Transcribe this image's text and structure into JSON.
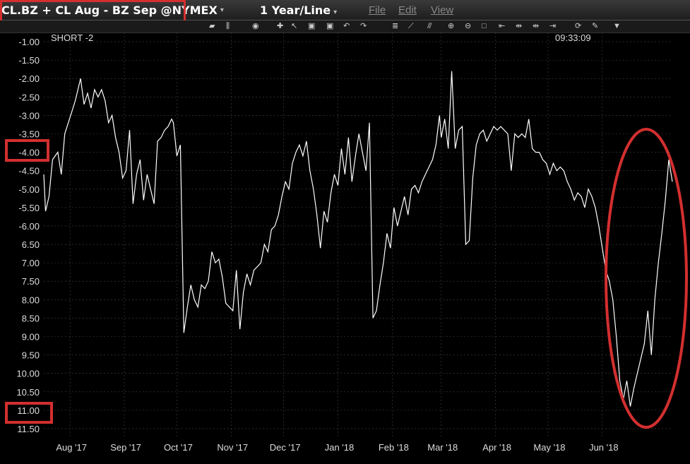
{
  "header": {
    "symbol": "CL.BZ + CL Aug - BZ Sep @NYMEX",
    "period": "1 Year/Line",
    "menu": [
      "File",
      "Edit",
      "View"
    ]
  },
  "legend": {
    "label": "SHORT -2",
    "time": "09:33:09"
  },
  "colors": {
    "background": "#000000",
    "line": "#ffffff",
    "annotation": "#d32f2f",
    "grid": "#444444"
  },
  "chart_data": {
    "type": "line",
    "ylim": [
      -11.75,
      -0.75
    ],
    "yticks": [
      "-1.00",
      "-1.50",
      "-2.00",
      "-2.50",
      "-3.00",
      "-3.50",
      "-4.00",
      "-4.50",
      "-5.00",
      "-5.50",
      "-6.00",
      "-6.50",
      "-7.00",
      "-7.50",
      "-8.00",
      "-8.50",
      "-9.00",
      "-9.50",
      "-10.00",
      "-10.50",
      "-11.00",
      "-11.50"
    ],
    "ytick_display": [
      "-1.00",
      "-1.50",
      "-2.00",
      "-2.50",
      "-3.00",
      "-3.50",
      "-4.00",
      "-4.50",
      "-5.00",
      "-5.50",
      "-6.00",
      "6.50",
      "7.00",
      "7.50",
      "8.00",
      "8.50",
      "9.00",
      "9.50",
      "10.00",
      "10.50",
      "11.00",
      "11.50"
    ],
    "months": [
      "Aug '17",
      "Sep '17",
      "Oct '17",
      "Nov '17",
      "Dec '17",
      "Jan '18",
      "Feb '18",
      "Mar '18",
      "Apr '18",
      "May '18",
      "Jun '18"
    ],
    "x_start": "2017-07-17",
    "x_end": "2018-07-11",
    "highlighted_ticks": [
      "-4.00",
      "-11.00"
    ],
    "series": [
      {
        "values": [
          [
            "2017-07-17",
            -4.6
          ],
          [
            "2017-07-18",
            -5.6
          ],
          [
            "2017-07-20",
            -5.2
          ],
          [
            "2017-07-22",
            -4.2
          ],
          [
            "2017-07-25",
            -4.0
          ],
          [
            "2017-07-27",
            -4.6
          ],
          [
            "2017-07-29",
            -3.5
          ],
          [
            "2017-07-31",
            -3.2
          ],
          [
            "2017-08-02",
            -2.9
          ],
          [
            "2017-08-04",
            -2.6
          ],
          [
            "2017-08-07",
            -2.0
          ],
          [
            "2017-08-09",
            -2.7
          ],
          [
            "2017-08-11",
            -2.4
          ],
          [
            "2017-08-13",
            -2.8
          ],
          [
            "2017-08-15",
            -2.3
          ],
          [
            "2017-08-17",
            -2.5
          ],
          [
            "2017-08-19",
            -2.3
          ],
          [
            "2017-08-21",
            -2.6
          ],
          [
            "2017-08-23",
            -3.2
          ],
          [
            "2017-08-25",
            -3.0
          ],
          [
            "2017-08-27",
            -3.6
          ],
          [
            "2017-08-29",
            -4.0
          ],
          [
            "2017-08-31",
            -4.7
          ],
          [
            "2017-09-02",
            -4.5
          ],
          [
            "2017-09-04",
            -3.4
          ],
          [
            "2017-09-06",
            -5.4
          ],
          [
            "2017-09-08",
            -4.6
          ],
          [
            "2017-09-10",
            -4.2
          ],
          [
            "2017-09-12",
            -5.3
          ],
          [
            "2017-09-14",
            -4.6
          ],
          [
            "2017-09-16",
            -5.0
          ],
          [
            "2017-09-18",
            -5.4
          ],
          [
            "2017-09-20",
            -3.7
          ],
          [
            "2017-09-22",
            -3.6
          ],
          [
            "2017-09-24",
            -3.4
          ],
          [
            "2017-09-26",
            -3.3
          ],
          [
            "2017-09-28",
            -3.1
          ],
          [
            "2017-09-29",
            -3.2
          ],
          [
            "2017-10-01",
            -4.1
          ],
          [
            "2017-10-03",
            -3.8
          ],
          [
            "2017-10-05",
            -8.9
          ],
          [
            "2017-10-07",
            -8.2
          ],
          [
            "2017-10-09",
            -7.6
          ],
          [
            "2017-10-11",
            -8.0
          ],
          [
            "2017-10-13",
            -8.2
          ],
          [
            "2017-10-15",
            -7.6
          ],
          [
            "2017-10-17",
            -7.7
          ],
          [
            "2017-10-19",
            -7.5
          ],
          [
            "2017-10-21",
            -6.7
          ],
          [
            "2017-10-23",
            -7.0
          ],
          [
            "2017-10-25",
            -6.9
          ],
          [
            "2017-10-27",
            -7.4
          ],
          [
            "2017-10-29",
            -8.1
          ],
          [
            "2017-10-31",
            -8.2
          ],
          [
            "2017-11-02",
            -8.3
          ],
          [
            "2017-11-04",
            -7.2
          ],
          [
            "2017-11-06",
            -8.8
          ],
          [
            "2017-11-08",
            -7.8
          ],
          [
            "2017-11-10",
            -7.3
          ],
          [
            "2017-11-12",
            -7.6
          ],
          [
            "2017-11-14",
            -7.2
          ],
          [
            "2017-11-16",
            -7.1
          ],
          [
            "2017-11-18",
            -7.0
          ],
          [
            "2017-11-20",
            -6.5
          ],
          [
            "2017-11-22",
            -6.7
          ],
          [
            "2017-11-24",
            -6.1
          ],
          [
            "2017-11-26",
            -6.0
          ],
          [
            "2017-11-28",
            -5.7
          ],
          [
            "2017-11-30",
            -5.2
          ],
          [
            "2017-12-02",
            -4.8
          ],
          [
            "2017-12-04",
            -5.0
          ],
          [
            "2017-12-06",
            -4.3
          ],
          [
            "2017-12-08",
            -4.0
          ],
          [
            "2017-12-10",
            -3.8
          ],
          [
            "2017-12-12",
            -4.1
          ],
          [
            "2017-12-14",
            -3.7
          ],
          [
            "2017-12-16",
            -4.5
          ],
          [
            "2017-12-18",
            -5.0
          ],
          [
            "2017-12-20",
            -5.7
          ],
          [
            "2017-12-22",
            -6.6
          ],
          [
            "2017-12-24",
            -5.6
          ],
          [
            "2017-12-26",
            -5.9
          ],
          [
            "2017-12-28",
            -5.1
          ],
          [
            "2017-12-30",
            -4.6
          ],
          [
            "2018-01-01",
            -4.9
          ],
          [
            "2018-01-03",
            -3.9
          ],
          [
            "2018-01-05",
            -4.6
          ],
          [
            "2018-01-07",
            -3.6
          ],
          [
            "2018-01-09",
            -4.8
          ],
          [
            "2018-01-11",
            -4.1
          ],
          [
            "2018-01-13",
            -3.5
          ],
          [
            "2018-01-15",
            -4.0
          ],
          [
            "2018-01-17",
            -4.5
          ],
          [
            "2018-01-19",
            -3.2
          ],
          [
            "2018-01-21",
            -8.5
          ],
          [
            "2018-01-23",
            -8.3
          ],
          [
            "2018-01-25",
            -7.6
          ],
          [
            "2018-01-27",
            -7.0
          ],
          [
            "2018-01-29",
            -6.2
          ],
          [
            "2018-01-31",
            -6.6
          ],
          [
            "2018-02-02",
            -5.5
          ],
          [
            "2018-02-04",
            -6.0
          ],
          [
            "2018-02-06",
            -5.6
          ],
          [
            "2018-02-08",
            -5.2
          ],
          [
            "2018-02-10",
            -5.7
          ],
          [
            "2018-02-12",
            -5.0
          ],
          [
            "2018-02-14",
            -4.9
          ],
          [
            "2018-02-16",
            -5.1
          ],
          [
            "2018-02-18",
            -4.8
          ],
          [
            "2018-02-20",
            -4.6
          ],
          [
            "2018-02-22",
            -4.4
          ],
          [
            "2018-02-24",
            -4.2
          ],
          [
            "2018-02-26",
            -3.8
          ],
          [
            "2018-02-28",
            -3.0
          ],
          [
            "2018-03-01",
            -3.6
          ],
          [
            "2018-03-03",
            -3.1
          ],
          [
            "2018-03-05",
            -3.9
          ],
          [
            "2018-03-07",
            -1.8
          ],
          [
            "2018-03-09",
            -3.9
          ],
          [
            "2018-03-11",
            -3.4
          ],
          [
            "2018-03-13",
            -3.3
          ],
          [
            "2018-03-15",
            -6.5
          ],
          [
            "2018-03-17",
            -6.4
          ],
          [
            "2018-03-19",
            -4.7
          ],
          [
            "2018-03-21",
            -3.8
          ],
          [
            "2018-03-23",
            -3.5
          ],
          [
            "2018-03-25",
            -3.4
          ],
          [
            "2018-03-27",
            -3.7
          ],
          [
            "2018-03-29",
            -3.5
          ],
          [
            "2018-03-31",
            -3.3
          ],
          [
            "2018-04-02",
            -3.4
          ],
          [
            "2018-04-04",
            -3.3
          ],
          [
            "2018-04-06",
            -3.4
          ],
          [
            "2018-04-08",
            -3.5
          ],
          [
            "2018-04-10",
            -4.5
          ],
          [
            "2018-04-12",
            -3.5
          ],
          [
            "2018-04-14",
            -3.6
          ],
          [
            "2018-04-16",
            -3.5
          ],
          [
            "2018-04-18",
            -3.6
          ],
          [
            "2018-04-20",
            -3.1
          ],
          [
            "2018-04-22",
            -3.9
          ],
          [
            "2018-04-24",
            -4.0
          ],
          [
            "2018-04-26",
            -4.0
          ],
          [
            "2018-04-28",
            -4.2
          ],
          [
            "2018-04-30",
            -4.3
          ],
          [
            "2018-05-02",
            -4.6
          ],
          [
            "2018-05-04",
            -4.3
          ],
          [
            "2018-05-06",
            -4.5
          ],
          [
            "2018-05-08",
            -4.4
          ],
          [
            "2018-05-10",
            -4.5
          ],
          [
            "2018-05-12",
            -4.8
          ],
          [
            "2018-05-14",
            -5.0
          ],
          [
            "2018-05-16",
            -5.3
          ],
          [
            "2018-05-18",
            -5.1
          ],
          [
            "2018-05-20",
            -5.2
          ],
          [
            "2018-05-22",
            -5.5
          ],
          [
            "2018-05-24",
            -5.0
          ],
          [
            "2018-05-26",
            -5.2
          ],
          [
            "2018-05-28",
            -5.5
          ],
          [
            "2018-05-30",
            -6.0
          ],
          [
            "2018-06-01",
            -6.6
          ],
          [
            "2018-06-03",
            -7.2
          ],
          [
            "2018-06-05",
            -7.5
          ],
          [
            "2018-06-07",
            -8.0
          ],
          [
            "2018-06-09",
            -9.0
          ],
          [
            "2018-06-11",
            -10.2
          ],
          [
            "2018-06-13",
            -10.7
          ],
          [
            "2018-06-15",
            -10.2
          ],
          [
            "2018-06-17",
            -10.9
          ],
          [
            "2018-06-19",
            -10.4
          ],
          [
            "2018-06-21",
            -10.0
          ],
          [
            "2018-06-23",
            -9.6
          ],
          [
            "2018-06-25",
            -9.2
          ],
          [
            "2018-06-27",
            -8.3
          ],
          [
            "2018-06-29",
            -9.5
          ],
          [
            "2018-07-01",
            -8.0
          ],
          [
            "2018-07-03",
            -7.0
          ],
          [
            "2018-07-05",
            -6.2
          ],
          [
            "2018-07-07",
            -5.3
          ],
          [
            "2018-07-09",
            -4.2
          ],
          [
            "2018-07-11",
            -4.8
          ]
        ]
      }
    ]
  }
}
